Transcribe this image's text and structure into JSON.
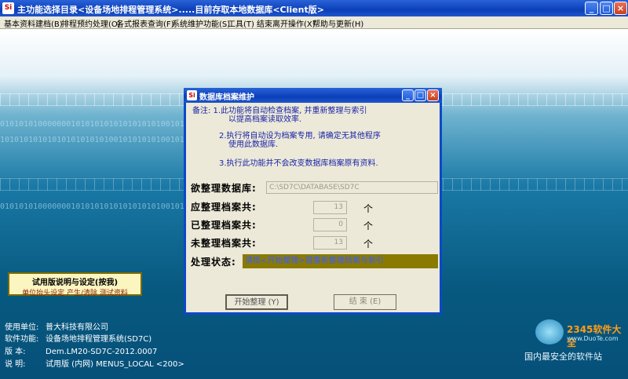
{
  "window": {
    "title": "主功能选择目录<设备场地排程管理系统>.....目前存取本地数据库<Client版>",
    "app_icon": "Si",
    "minimize": "_",
    "maximize": "□",
    "close": "×"
  },
  "menu": [
    "基本资料建档(B)",
    "排程预约处理(O)",
    "各式报表查询(F)",
    "系统维护功能(S)",
    "工具(T)",
    "结束离开操作(X)",
    "帮助与更新(H)"
  ],
  "background": {
    "binary_rows": [
      "0101010100000001010101010101010101001010101010101010101",
      "1010101010101010101010100101010101001010101010101010101",
      "0101010100000001010101010101010101001010101010101010101"
    ]
  },
  "trial_box": {
    "title": "试用版说明与设定(按我)",
    "subtitle": "单位抬头设定 产生/清除 测试资料"
  },
  "info": {
    "unit_label": "使用单位:",
    "unit_value": "普大科技有限公司",
    "function_label": "软件功能:",
    "function_value": "设备场地排程管理系统(SD7C)",
    "version_label": "版    本:",
    "version_value": "Dem.LM20-SD7C-2012.0007",
    "note_label": "说    明:",
    "note_value": "试用版 (内网) MENUS_LOCAL <200>"
  },
  "brand": {
    "logo_text": "2345软件大全",
    "url": "www.DuoTe.com",
    "slogan": "国内最安全的软件站"
  },
  "dialog": {
    "title": "数据库档案维护",
    "icon": "Si",
    "notes": [
      "备注: 1.此功能将自动检查档案, 并重新整理与索引",
      "以提高档案读取效率.",
      "2.执行将自动设为档案专用, 请确定无其他程序",
      "使用此数据库.",
      "3.执行此功能并不会改变数据库档案原有资料."
    ],
    "db_label": "欲整理数据库:",
    "db_value": "C:\\SD7C\\DATABASE\\SD7C",
    "total_label": "应整理档案共:",
    "total_value": "13",
    "done_label": "已整理档案共:",
    "done_value": "0",
    "remain_label": "未整理档案共:",
    "remain_value": "13",
    "unit": "个",
    "status_label": "处理状态:",
    "status_value": "请按<开始整理>键重新整理档案与索引",
    "start_button": "开始整理 (Y)",
    "end_button": "结    束 (E)",
    "watermark": "www.DuoTe.com"
  },
  "colors": {
    "titlebar": "#0a3fb8",
    "dialog_bg": "#ece9d8",
    "status_bg": "#8a7b00",
    "note_text": "#1b25a8"
  }
}
